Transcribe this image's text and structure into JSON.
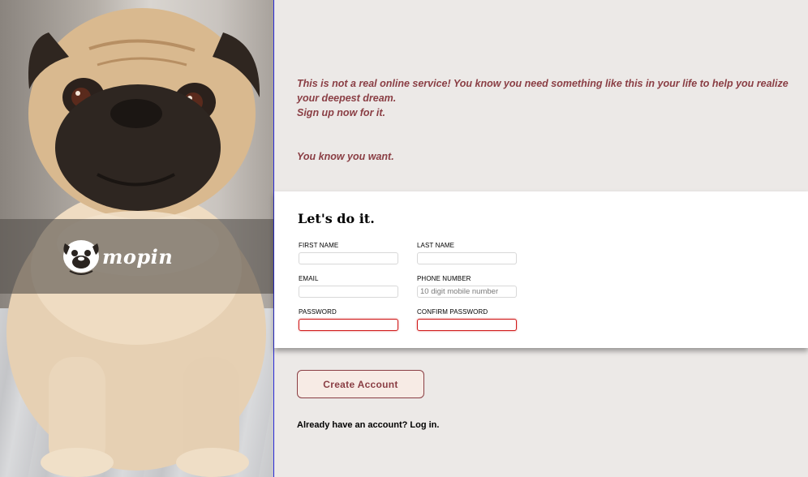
{
  "brand": {
    "logo_text": "mopin",
    "logo_icon": "pug-face-icon"
  },
  "intro": {
    "line1": "This is not a real online service! You know you need something like this in your life to help you realize your deepest dream.",
    "line2": "Sign up now for it.",
    "line3": "You know you want."
  },
  "form": {
    "title": "Let's do it.",
    "fields": {
      "first_name": {
        "label": "First Name",
        "value": "",
        "placeholder": ""
      },
      "last_name": {
        "label": "Last Name",
        "value": "",
        "placeholder": ""
      },
      "email": {
        "label": "Email",
        "value": "",
        "placeholder": ""
      },
      "phone": {
        "label": "Phone Number",
        "value": "",
        "placeholder": "10 digit mobile number"
      },
      "password": {
        "label": "Password",
        "value": "",
        "placeholder": ""
      },
      "confirm_password": {
        "label": "Confirm Password",
        "value": "",
        "placeholder": ""
      }
    }
  },
  "actions": {
    "create_label": "Create Account",
    "login_prompt": "Already have an account?",
    "login_link": "Log in."
  },
  "colors": {
    "accent": "#8a3e44",
    "page_background": "#ece9e7",
    "invalid_border": "#d01919"
  }
}
